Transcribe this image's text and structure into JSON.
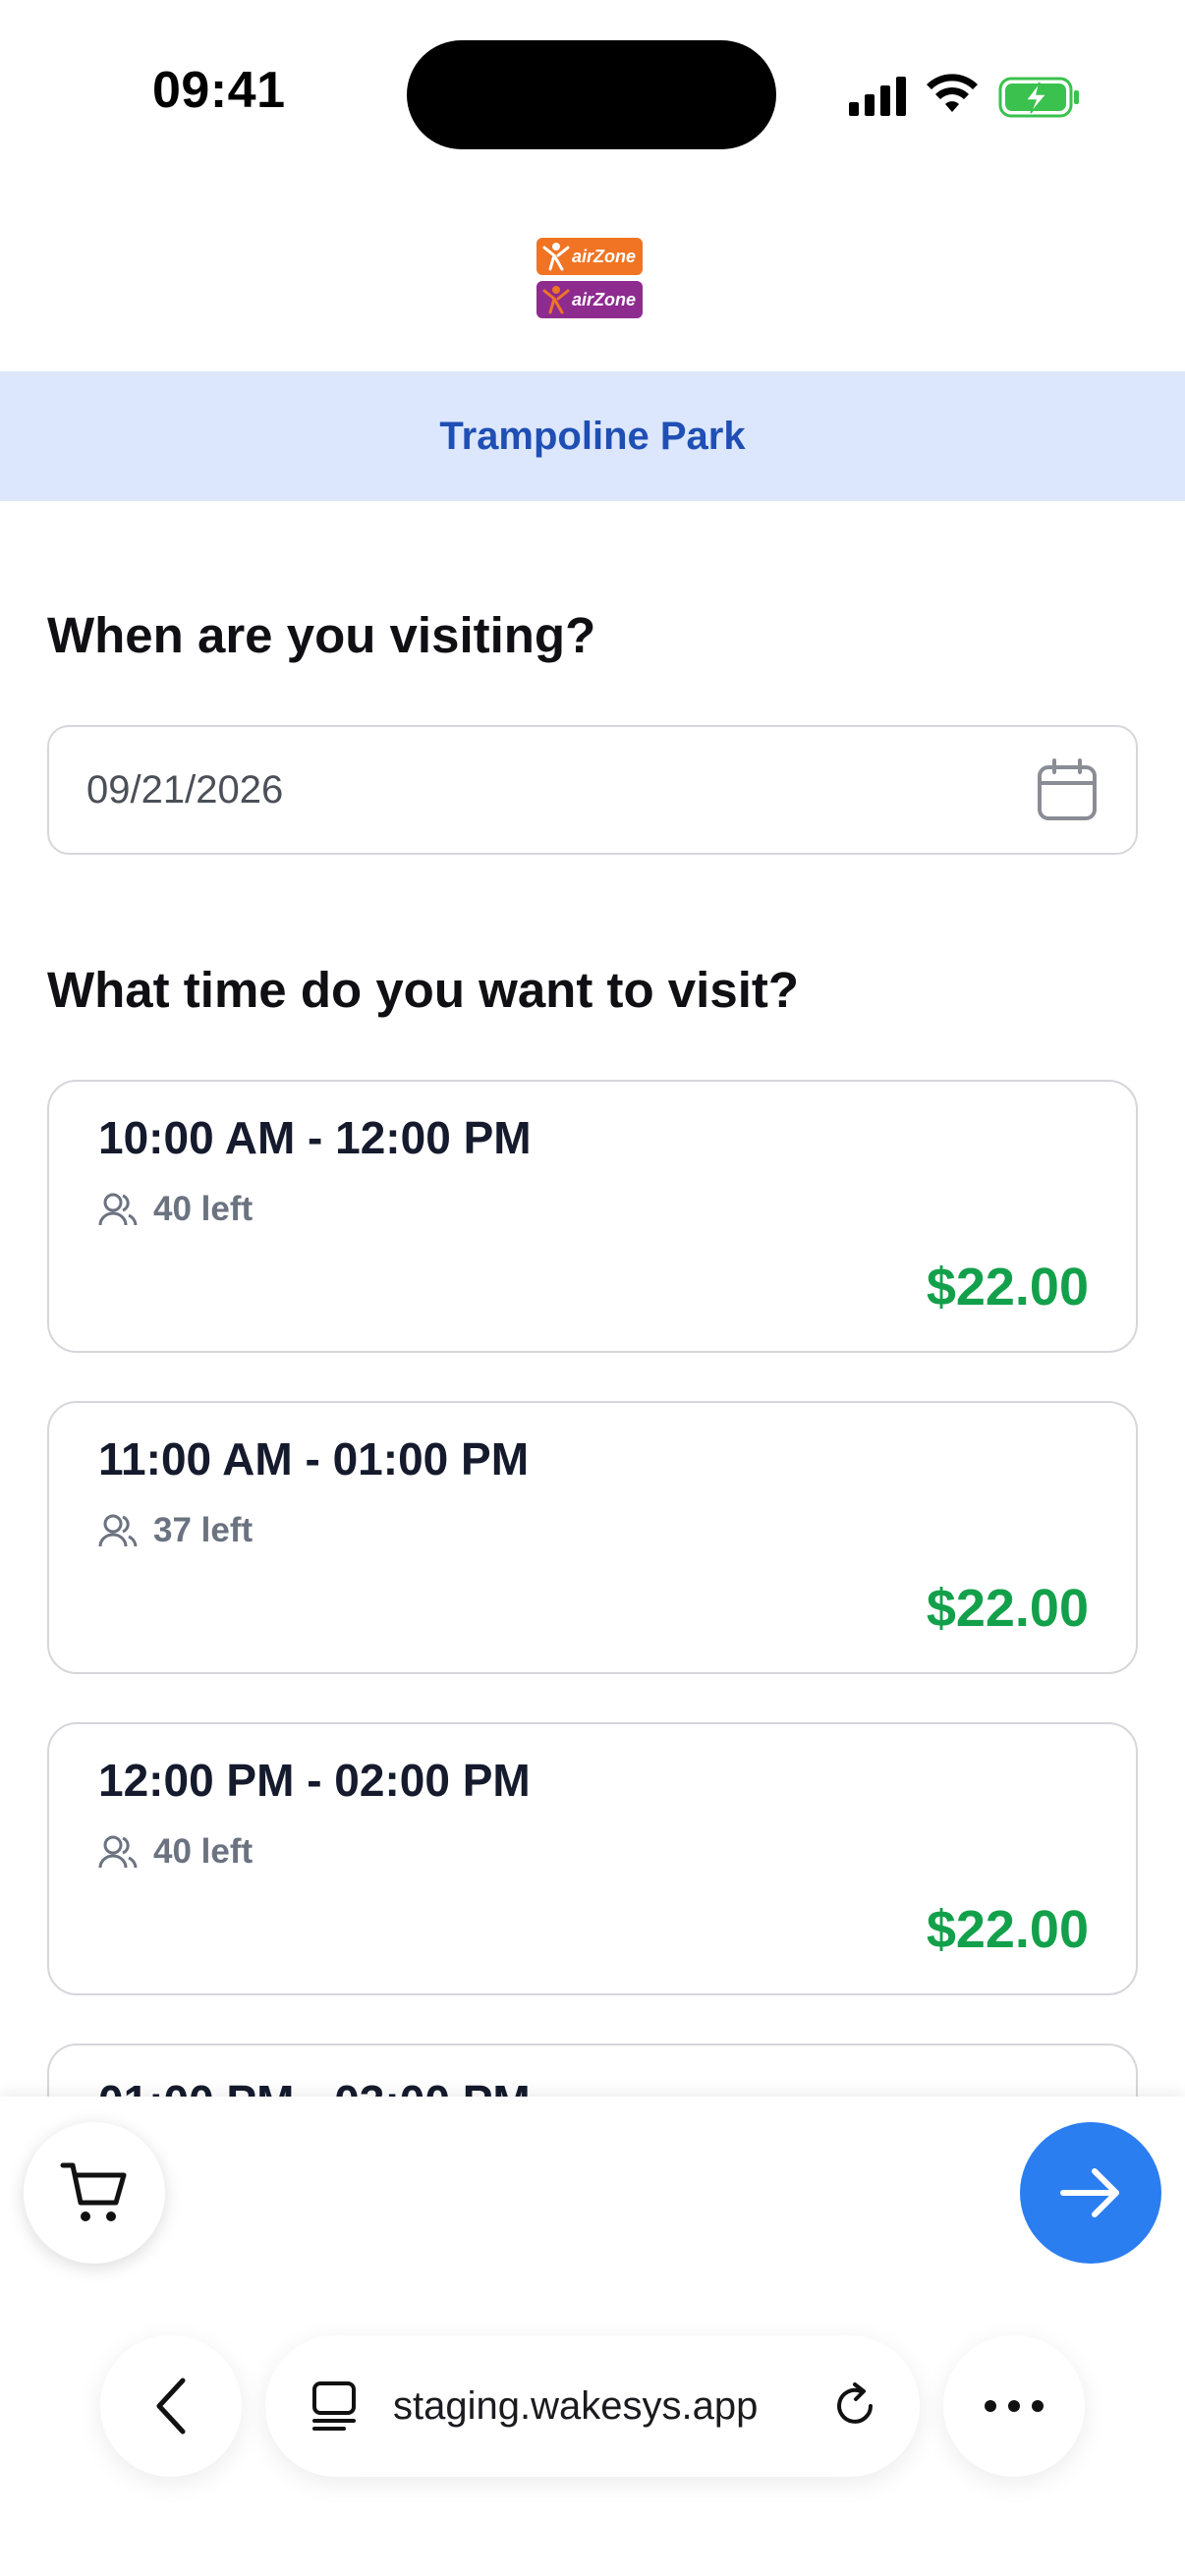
{
  "status_bar": {
    "time": "09:41"
  },
  "logo": {
    "brand_text": "airZone",
    "colors": [
      "#f07423",
      "#8e2b8f"
    ]
  },
  "park": {
    "name": "Trampoline Park"
  },
  "date_section": {
    "heading": "When are you visiting?",
    "date_value": "09/21/2026",
    "icon": "calendar-icon"
  },
  "time_section": {
    "heading": "What time do you want to visit?",
    "slots": [
      {
        "time": "10:00 AM - 12:00 PM",
        "left": "40 left",
        "price": "$22.00"
      },
      {
        "time": "11:00 AM - 01:00 PM",
        "left": "37 left",
        "price": "$22.00"
      },
      {
        "time": "12:00 PM - 02:00 PM",
        "left": "40 left",
        "price": "$22.00"
      },
      {
        "time": "01:00 PM - 03:00 PM",
        "left": "",
        "price": ""
      }
    ]
  },
  "actions": {
    "cart_icon": "cart-icon",
    "next_icon": "arrow-right-icon"
  },
  "browser": {
    "url": "staging.wakesys.app"
  },
  "colors": {
    "accent": "#2b7ef0",
    "price": "#13a04b",
    "banner_bg": "#dce7fd",
    "banner_text": "#1f4fb4"
  }
}
